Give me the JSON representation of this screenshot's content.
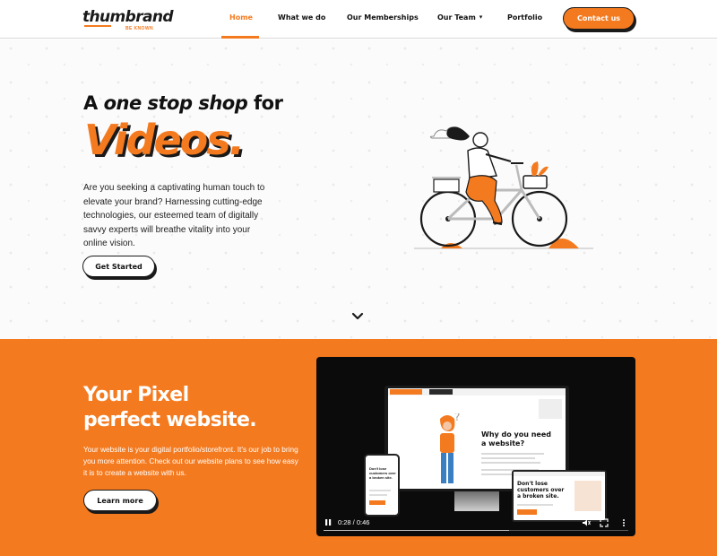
{
  "brand": {
    "name": "thumbrand",
    "tagline": "BE KNOWN"
  },
  "nav": {
    "items": [
      "Home",
      "What we do",
      "Our Memberships",
      "Our Team",
      "Portfolio"
    ],
    "active": "Home",
    "contact_label": "Contact us"
  },
  "hero": {
    "title_prefix": "A ",
    "title_em": "one stop shop",
    "title_suffix": " for",
    "big_word": "Videos.",
    "description": "Are you seeking a captivating human touch to elevate your brand? Harnessing cutting-edge technologies, our esteemed team of digitally savvy experts will breathe vitality into your online vision.",
    "cta": "Get Started"
  },
  "promo": {
    "title_line1": "Your Pixel",
    "title_line2": "perfect website.",
    "description": "Your website is your digital portfolio/storefront. It's our job to bring you more attention. Check out our website plans to see how easy it is to create a website with us.",
    "cta": "Learn more"
  },
  "video": {
    "monitor_heading": "Why do you need a website?",
    "phone_text": "Don't lose customers over a broken site.",
    "tablet_text": "Don't lose customers over a broken site.",
    "current_time": "0:28",
    "duration": "0:46",
    "time_display": "0:28 / 0:46",
    "progress": 0.61
  },
  "colors": {
    "accent": "#f47a1f",
    "dark": "#1a1a1a"
  },
  "icons": [
    "chevron-down-icon",
    "play-pause-icon",
    "volume-icon",
    "fullscreen-icon",
    "more-options-icon"
  ]
}
